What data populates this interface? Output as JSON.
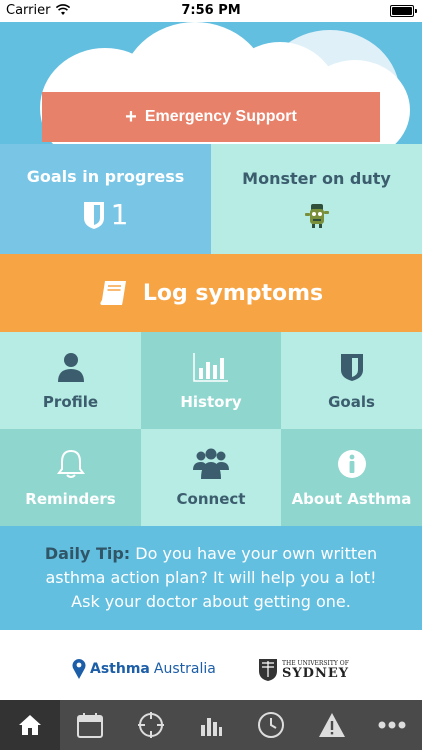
{
  "status_bar": {
    "carrier": "Carrier",
    "time": "7:56 PM",
    "battery_level": 1.0
  },
  "emergency": {
    "label": "Emergency Support",
    "icon": "plus-icon",
    "color": "#e8816a"
  },
  "goals_tile": {
    "title": "Goals in progress",
    "count": "1",
    "icon": "shield-icon"
  },
  "monster_tile": {
    "title": "Monster on duty",
    "icon": "monster-icon"
  },
  "log_tile": {
    "label": "Log symptoms",
    "icon": "book-icon",
    "color": "#f7a445"
  },
  "grid": [
    {
      "label": "Profile",
      "icon": "person-icon"
    },
    {
      "label": "History",
      "icon": "bar-chart-icon"
    },
    {
      "label": "Goals",
      "icon": "shield-icon"
    },
    {
      "label": "Reminders",
      "icon": "bell-icon"
    },
    {
      "label": "Connect",
      "icon": "group-icon"
    },
    {
      "label": "About Asthma",
      "icon": "info-icon"
    }
  ],
  "daily_tip": {
    "label": "Daily Tip:",
    "text": "Do you have your own written asthma action plan? It will help you a lot! Ask your doctor about getting one."
  },
  "partners": {
    "asthma_bold": "Asthma",
    "asthma_rest": "Australia",
    "sydney_small": "THE UNIVERSITY OF",
    "sydney_big": "SYDNEY"
  },
  "tabs": [
    {
      "icon": "home-icon",
      "active": true
    },
    {
      "icon": "calendar-icon",
      "active": false
    },
    {
      "icon": "target-icon",
      "active": false
    },
    {
      "icon": "bar-chart-icon",
      "active": false
    },
    {
      "icon": "clock-icon",
      "active": false
    },
    {
      "icon": "warning-icon",
      "active": false
    },
    {
      "icon": "more-icon",
      "active": false
    }
  ],
  "colors": {
    "sky": "#63bfe0",
    "mint": "#b6ece4",
    "teal": "#8fd6cf",
    "blue": "#78c5e6",
    "tabbar": "#4a4a4a"
  }
}
